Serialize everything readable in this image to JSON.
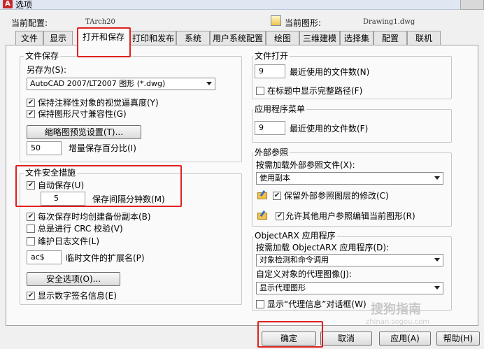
{
  "window": {
    "title": "选项"
  },
  "header": {
    "current_profile_label": "当前配置:",
    "current_profile_value": "TArch20",
    "current_drawing_label": "当前图形:",
    "current_drawing_value": "Drawing1.dwg"
  },
  "tabs": [
    {
      "label": "文件"
    },
    {
      "label": "显示"
    },
    {
      "label": "打开和保存"
    },
    {
      "label": "打印和发布"
    },
    {
      "label": "系统"
    },
    {
      "label": "用户系统配置"
    },
    {
      "label": "绘图"
    },
    {
      "label": "三维建模"
    },
    {
      "label": "选择集"
    },
    {
      "label": "配置"
    },
    {
      "label": "联机"
    }
  ],
  "active_tab": "打开和保存",
  "file_save": {
    "title": "文件保存",
    "save_as_label": "另存为(S):",
    "save_as_value": "AutoCAD 2007/LT2007 图形 (*.dwg)",
    "maintain_visual_fidelity": {
      "label": "保持注释性对象的视觉逼真度(Y)",
      "checked": true
    },
    "maintain_drawing_size": {
      "label": "保持图形尺寸兼容性(G)",
      "checked": true
    },
    "thumbnail_button": "缩略图预览设置(T)...",
    "incremental_value": "50",
    "incremental_label": "增量保存百分比(I)"
  },
  "file_safety": {
    "title": "文件安全措施",
    "autosave": {
      "label": "自动保存(U)",
      "checked": true
    },
    "autosave_minutes_value": "5",
    "autosave_minutes_label": "保存间隔分钟数(M)",
    "backup_copy": {
      "label": "每次保存时均创建备份副本(B)",
      "checked": true
    },
    "crc_check": {
      "label": "总是进行 CRC 校验(V)",
      "checked": false
    },
    "log_file": {
      "label": "维护日志文件(L)",
      "checked": false
    },
    "temp_ext_value": "ac$",
    "temp_ext_label": "临时文件的扩展名(P)",
    "security_button": "安全选项(O)...",
    "digital_signature": {
      "label": "显示数字签名信息(E)",
      "checked": true
    }
  },
  "file_open": {
    "title": "文件打开",
    "recent_files_value": "9",
    "recent_files_label": "最近使用的文件数(N)",
    "full_path": {
      "label": "在标题中显示完整路径(F)",
      "checked": false
    }
  },
  "app_menu": {
    "title": "应用程序菜单",
    "recent_files_value": "9",
    "recent_files_label": "最近使用的文件数(F)"
  },
  "xref": {
    "title": "外部参照",
    "demand_load_label": "按需加载外部参照文件(X):",
    "demand_load_value": "使用副本",
    "retain_changes": {
      "label": "保留外部参照图层的修改(C)",
      "checked": true
    },
    "allow_edit": {
      "label": "允许其他用户参照编辑当前图形(R)",
      "checked": true
    }
  },
  "objectarx": {
    "title": "ObjectARX 应用程序",
    "demand_load_label": "按需加载 ObjectARX 应用程序(D):",
    "demand_load_value": "对象检测和命令调用",
    "proxy_images_label": "自定义对象的代理图像(J):",
    "proxy_images_value": "显示代理图形",
    "proxy_info": {
      "label": "显示“代理信息”对话框(W)",
      "checked": false
    }
  },
  "buttons": {
    "ok": "确定",
    "cancel": "取消",
    "apply": "应用(A)",
    "help": "帮助(H)"
  },
  "watermark": {
    "text": "搜狗指南",
    "url": "zhinan.sogou.com"
  }
}
